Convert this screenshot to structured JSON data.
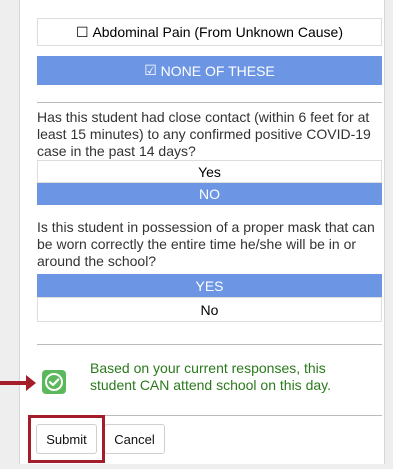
{
  "symptoms": {
    "abdominal_pain": {
      "checkbox": "☐",
      "label": "Abdominal Pain (From Unknown Cause)"
    },
    "none_of_these": {
      "checkbox": "☑",
      "label": "NONE OF THESE"
    }
  },
  "question_contact": {
    "text": "Has this student had close contact (within 6 feet for at least 15 minutes) to any confirmed positive COVID-19 case in the past 14 days?",
    "option_yes": "Yes",
    "option_no": "NO",
    "selected": "NO"
  },
  "question_mask": {
    "text": "Is this student in possession of a proper mask that can be worn correctly the entire time he/she will be in or around the school?",
    "option_yes": "YES",
    "option_no": "No",
    "selected": "YES"
  },
  "status": {
    "message": "Based on your current responses, this student CAN attend school on this day.",
    "icon": "check-icon",
    "color": "#2a7a1c"
  },
  "actions": {
    "submit_label": "Submit",
    "cancel_label": "Cancel"
  },
  "colors": {
    "selected_option": "#6c96e4",
    "success_icon": "#5cb85c",
    "annotation": "#a51c2a"
  }
}
